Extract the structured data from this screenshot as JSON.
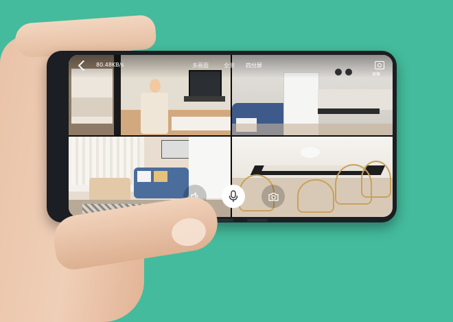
{
  "colors": {
    "background": "#44bb9c",
    "phone_body": "#1b1e22"
  },
  "topbar": {
    "net_speed": "80.48KB/s",
    "tabs": [
      {
        "label": "多画面",
        "active": false
      },
      {
        "label": "全景",
        "active": false
      },
      {
        "label": "四分屏",
        "active": true
      }
    ],
    "record_label": "录像"
  },
  "tiles": [
    {
      "scene": "bedroom-tv"
    },
    {
      "scene": "kitchen"
    },
    {
      "scene": "living-room"
    },
    {
      "scene": "dining-room"
    }
  ],
  "controls": {
    "icons": [
      "speaker-icon",
      "microphone-icon",
      "camera-icon"
    ]
  }
}
